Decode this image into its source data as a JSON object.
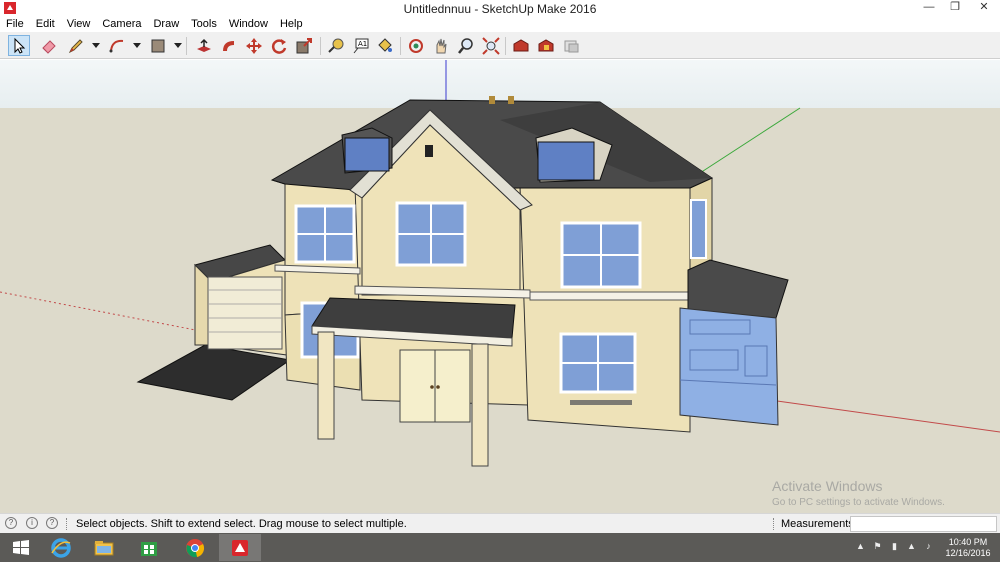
{
  "window": {
    "title": "Untitlednnuu - SketchUp Make 2016",
    "minimize_glyph": "—",
    "maximize_glyph": "❐",
    "close_glyph": "✕"
  },
  "menu": [
    "File",
    "Edit",
    "View",
    "Camera",
    "Draw",
    "Tools",
    "Window",
    "Help"
  ],
  "toolbar": {
    "tools": [
      "select-icon",
      "eraser-icon",
      "pencil-icon",
      "arc-icon",
      "rectangle-icon",
      "push-pull-icon",
      "follow-me-icon",
      "move-icon",
      "rotate-icon",
      "scale-icon",
      "tape-measure-icon",
      "text-icon",
      "paint-bucket-icon",
      "orbit-icon",
      "pan-icon",
      "zoom-icon",
      "zoom-extents-icon",
      "warehouse-icon",
      "extension-warehouse-icon",
      "send-to-layout-icon"
    ],
    "active_tool": "select-icon"
  },
  "viewport": {
    "watermark_title": "Activate Windows",
    "watermark_subtitle": "Go to PC settings to activate Windows."
  },
  "statusbar": {
    "hint": "Select objects. Shift to extend select. Drag mouse to select multiple.",
    "measurements_label": "Measurements",
    "measurements_value": ""
  },
  "taskbar": {
    "apps": [
      "start-icon",
      "internet-explorer-icon",
      "file-explorer-icon",
      "store-icon",
      "chrome-icon",
      "sketchup-icon"
    ],
    "time": "10:40 PM",
    "date": "12/16/2016"
  },
  "colors": {
    "ground": "#dddacb",
    "sky": "#eaf0f2",
    "wall": "#eee2b8",
    "roof": "#4a4a4a",
    "glass": "#7f9fd6",
    "taskbar": "#5b5a57"
  }
}
